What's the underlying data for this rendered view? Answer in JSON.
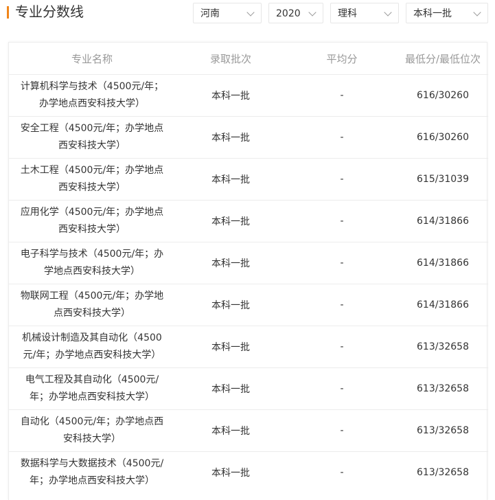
{
  "header": {
    "title": "专业分数线",
    "filters": [
      {
        "value": "河南"
      },
      {
        "value": "2020"
      },
      {
        "value": "理科"
      },
      {
        "value": "本科一批"
      }
    ]
  },
  "colors": {
    "accent": "#f08519",
    "border": "#ececec",
    "header_text": "#999999",
    "text": "#333333"
  },
  "table": {
    "columns": [
      "专业名称",
      "录取批次",
      "平均分",
      "最低分/最低位次"
    ],
    "rows": [
      {
        "name": "计算机科学与技术（4500元/年；办学地点西安科技大学）",
        "batch": "本科一批",
        "avg": "-",
        "min": "616/30260"
      },
      {
        "name": "安全工程（4500元/年；办学地点西安科技大学）",
        "batch": "本科一批",
        "avg": "-",
        "min": "616/30260"
      },
      {
        "name": "土木工程（4500元/年；办学地点西安科技大学）",
        "batch": "本科一批",
        "avg": "-",
        "min": "615/31039"
      },
      {
        "name": "应用化学（4500元/年；办学地点西安科技大学）",
        "batch": "本科一批",
        "avg": "-",
        "min": "614/31866"
      },
      {
        "name": "电子科学与技术（4500元/年；办学地点西安科技大学）",
        "batch": "本科一批",
        "avg": "-",
        "min": "614/31866"
      },
      {
        "name": "物联网工程（4500元/年；办学地点西安科技大学）",
        "batch": "本科一批",
        "avg": "-",
        "min": "614/31866"
      },
      {
        "name": "机械设计制造及其自动化（4500元/年；办学地点西安科技大学）",
        "batch": "本科一批",
        "avg": "-",
        "min": "613/32658"
      },
      {
        "name": "电气工程及其自动化（4500元/年；办学地点西安科技大学）",
        "batch": "本科一批",
        "avg": "-",
        "min": "613/32658"
      },
      {
        "name": "自动化（4500元/年；办学地点西安科技大学）",
        "batch": "本科一批",
        "avg": "-",
        "min": "613/32658"
      },
      {
        "name": "数据科学与大数据技术（4500元/年；办学地点西安科技大学）",
        "batch": "本科一批",
        "avg": "-",
        "min": "613/32658"
      }
    ]
  }
}
